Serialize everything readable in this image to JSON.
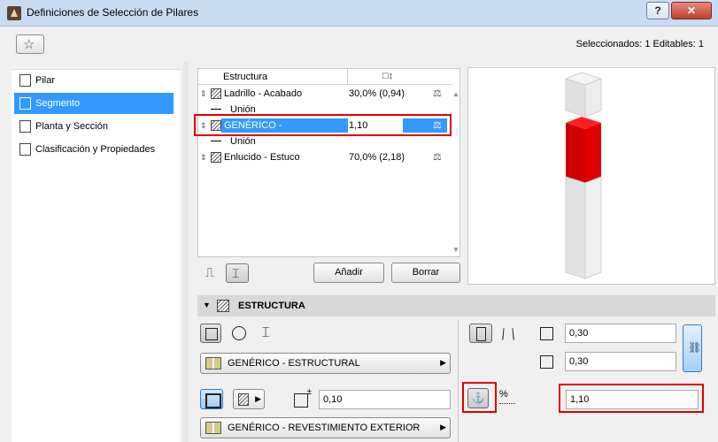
{
  "window": {
    "title": "Definiciones de Selección de Pilares",
    "help_label": "?",
    "close_label": "✕"
  },
  "topbar": {
    "status": "Seleccionados: 1 Editables: 1"
  },
  "nav": {
    "items": [
      {
        "label": "Pilar",
        "icon": "column-icon"
      },
      {
        "label": "Segmento",
        "icon": "segment-icon",
        "active": true
      },
      {
        "label": "Planta y Sección",
        "icon": "floor-plan-icon"
      },
      {
        "label": "Clasificación y Propiedades",
        "icon": "classification-icon"
      }
    ]
  },
  "tree": {
    "col_structure": "Estructura",
    "col_thickness_icon": "thickness-ratio-icon",
    "rows": [
      {
        "kind": "skin",
        "name": "Ladrillo - Acabado",
        "value": "30,0% (0,94)"
      },
      {
        "kind": "line",
        "name": "Unión"
      },
      {
        "kind": "skin",
        "name": "GENÉRICO - ESTRUCTURAL",
        "value": "1,10",
        "selected": true
      },
      {
        "kind": "line",
        "name": "Unión"
      },
      {
        "kind": "skin",
        "name": "Enlucido - Estuco",
        "value": "70,0% (2,18)"
      }
    ]
  },
  "buttons": {
    "add": "Añadir",
    "delete": "Borrar"
  },
  "section": {
    "title": "ESTRUCTURA"
  },
  "structure": {
    "core_material": "GENÉRICO - ESTRUCTURAL",
    "veneer_material": "GENÉRICO - REVESTIMIENTO EXTERIOR",
    "veneer_thickness": "0,10",
    "width": "0,30",
    "height": "0,30",
    "ratio": "1,10",
    "pct_label": "%"
  },
  "colors": {
    "accent": "#3399ff",
    "highlight": "#e00000",
    "segment": "#e00000"
  }
}
